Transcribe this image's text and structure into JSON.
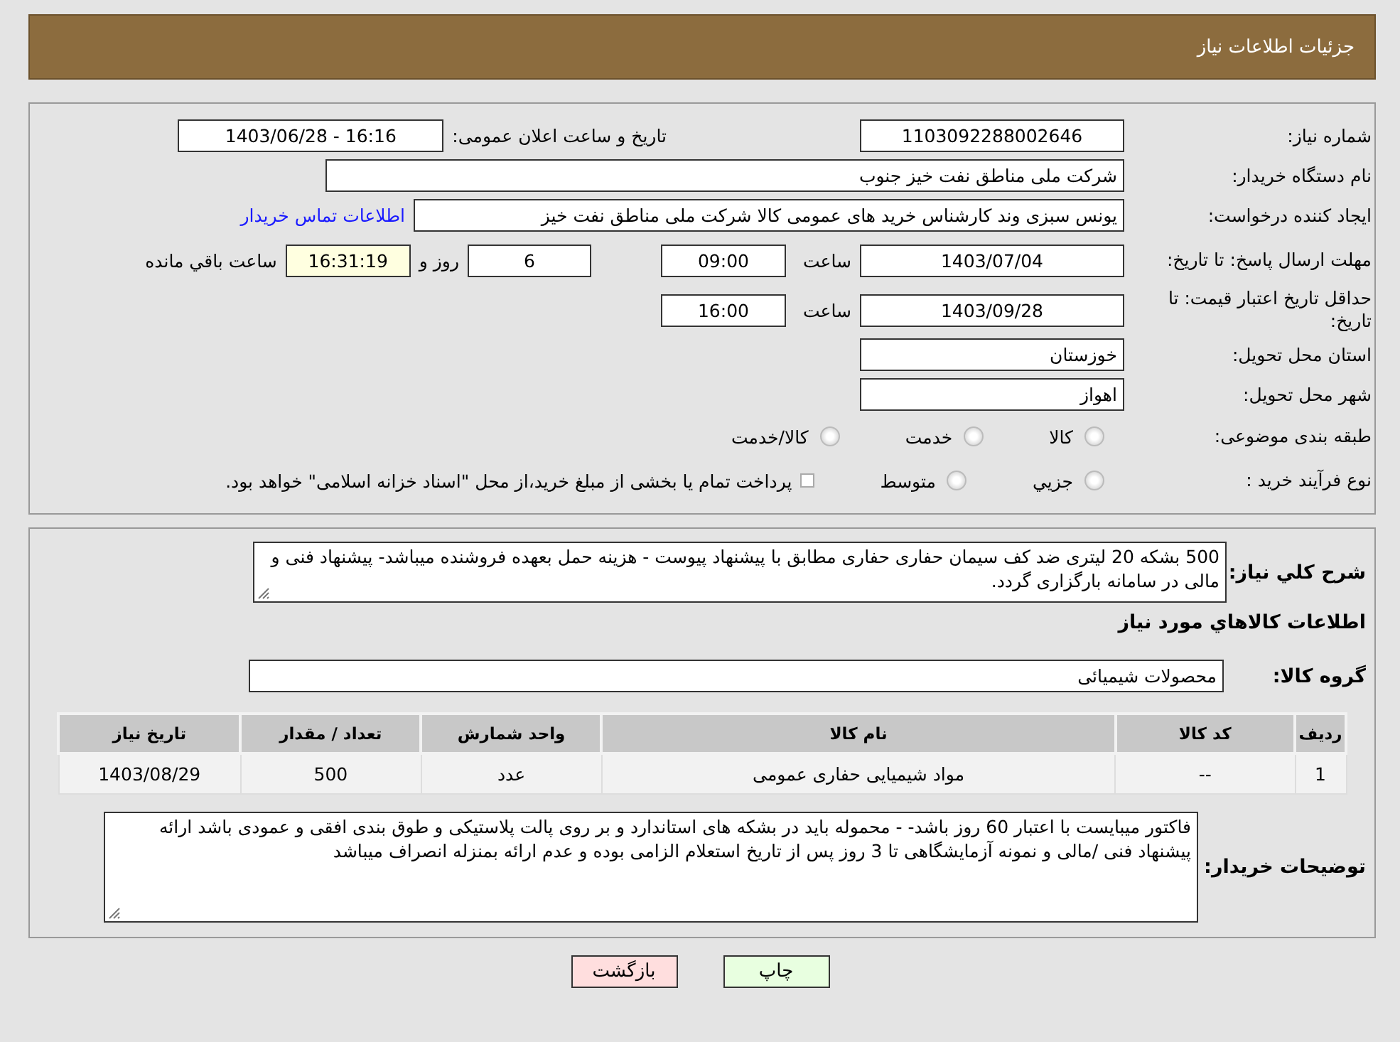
{
  "page_title": "جزئیات اطلاعات نیاز",
  "need_number": {
    "label": "شماره نیاز:",
    "value": "1103092288002646"
  },
  "announce_datetime": {
    "label": "تاریخ و ساعت اعلان عمومی:",
    "value": "1403/06/28 - 16:16"
  },
  "buyer_org": {
    "label": "نام دستگاه خریدار:",
    "value": "شرکت ملی مناطق نفت خیز جنوب"
  },
  "requester": {
    "label": "ایجاد کننده درخواست:",
    "value": "یونس سبزی وند کارشناس خرید های عمومی کالا شرکت ملی مناطق نفت خیز",
    "link": "اطلاعات تماس خریدار"
  },
  "reply_deadline": {
    "label": "مهلت ارسال پاسخ: تا تاریخ:",
    "date": "1403/07/04",
    "time_label": "ساعت",
    "time": "09:00",
    "days": "6",
    "days_label": "روز و",
    "remaining": "16:31:19",
    "remaining_label": "ساعت باقي مانده"
  },
  "price_validity": {
    "label": "حداقل تاریخ اعتبار قیمت: تا تاریخ:",
    "date": "1403/09/28",
    "time_label": "ساعت",
    "time": "16:00"
  },
  "province": {
    "label": "استان محل تحویل:",
    "value": "خوزستان"
  },
  "city": {
    "label": "شهر محل تحویل:",
    "value": "اهواز"
  },
  "category": {
    "label": "طبقه بندی موضوعی:",
    "options": [
      {
        "label": "کالا",
        "selected": false
      },
      {
        "label": "خدمت",
        "selected": false
      },
      {
        "label": "کالا/خدمت",
        "selected": false
      }
    ]
  },
  "purchase_type": {
    "label": "نوع فرآیند خرید :",
    "options": [
      {
        "label": "جزيي",
        "selected": false
      },
      {
        "label": "متوسط",
        "selected": false
      }
    ],
    "note": "پرداخت تمام یا بخشی از مبلغ خرید،از محل \"اسناد خزانه اسلامی\" خواهد بود.",
    "note_checked": false
  },
  "description": {
    "label": "شرح کلي نياز:",
    "text": "500 بشکه 20 لیتری ضد کف سیمان حفاری حفاری مطابق با پیشنهاد پیوست - هزینه حمل بعهده فروشنده میباشد- پیشنهاد فنی و مالی در سامانه بارگزاری گردد."
  },
  "goods_heading": "اطلاعات كالاهاي مورد نياز",
  "goods_group": {
    "label": "گروه کالا:",
    "value": "محصولات شیمیائی"
  },
  "table": {
    "columns": [
      "ردیف",
      "کد کالا",
      "نام کالا",
      "واحد شمارش",
      "تعداد / مقدار",
      "تاریخ نیاز"
    ],
    "rows": [
      [
        "1",
        "--",
        "مواد شیمیایی حفاری عمومی",
        "عدد",
        "500",
        "1403/08/29"
      ]
    ]
  },
  "buyer_notes": {
    "label": "توضیحات خریدار:",
    "text": "فاکتور میبایست با اعتبار 60 روز باشد- - محموله باید در بشکه های استاندارد و بر روی پالت پلاستیکی و طوق بندی افقی و عمودی باشد ارائه پیشنهاد فنی /مالی و نمونه آزمایشگاهی تا 3 روز پس از تاریخ استعلام الزامی بوده و عدم ارائه بمنزله انصراف میباشد"
  },
  "buttons": [
    {
      "label": "چاپ",
      "kind": "print"
    },
    {
      "label": "بازگشت",
      "kind": "back"
    }
  ]
}
